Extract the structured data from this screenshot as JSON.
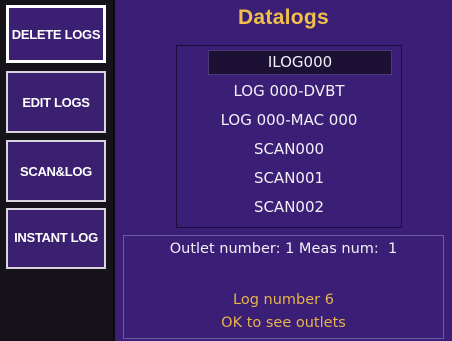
{
  "sidebar": {
    "buttons": [
      {
        "label": "DELETE LOGS"
      },
      {
        "label": "EDIT LOGS"
      },
      {
        "label": "SCAN&LOG"
      },
      {
        "label": "INSTANT LOG"
      }
    ]
  },
  "main": {
    "title": "Datalogs",
    "logs": [
      "ILOG000",
      "LOG 000-DVBT",
      "LOG 000-MAC 000",
      "SCAN000",
      "SCAN001",
      "SCAN002"
    ],
    "selected_index": 0,
    "info": {
      "outlet_line": "Outlet number: 1 Meas num:  1",
      "log_number": "Log number 6",
      "hint": "OK to see outlets"
    }
  },
  "colors": {
    "panel_bg": "#3b1e76",
    "title": "#f0c04a",
    "hint_text": "#e7b34a",
    "button_bg": "#3b2070"
  }
}
